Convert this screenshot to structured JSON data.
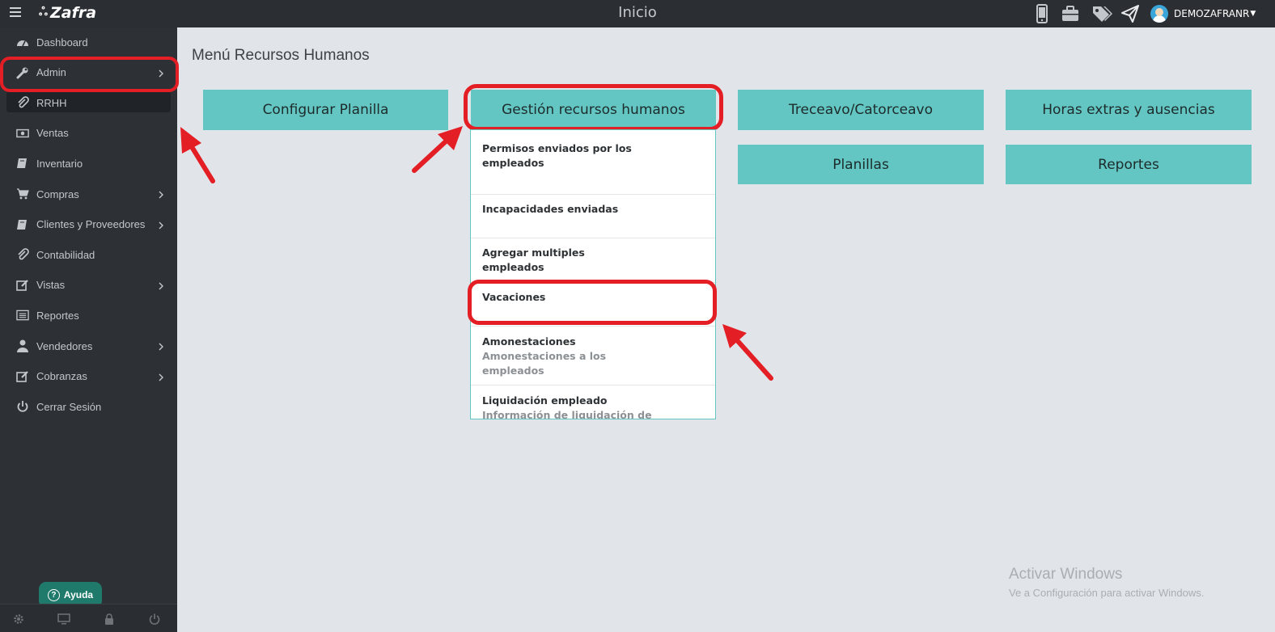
{
  "topbar": {
    "app_name": "Zafra",
    "title": "Inicio",
    "user": "DEMOZAFRANR"
  },
  "sidebar": {
    "items": [
      {
        "label": "Dashboard",
        "icon": "dashboard-icon",
        "has_submenu": false
      },
      {
        "label": "Admin",
        "icon": "wrench-icon",
        "has_submenu": true
      },
      {
        "label": "RRHH",
        "icon": "paperclip-icon",
        "has_submenu": false,
        "active": true
      },
      {
        "label": "Ventas",
        "icon": "money-icon",
        "has_submenu": false
      },
      {
        "label": "Inventario",
        "icon": "book-icon",
        "has_submenu": false
      },
      {
        "label": "Compras",
        "icon": "cart-icon",
        "has_submenu": true
      },
      {
        "label": "Clientes y Proveedores",
        "icon": "book-icon",
        "has_submenu": true
      },
      {
        "label": "Contabilidad",
        "icon": "paperclip-icon",
        "has_submenu": false
      },
      {
        "label": "Vistas",
        "icon": "edit-icon",
        "has_submenu": true
      },
      {
        "label": "Reportes",
        "icon": "list-icon",
        "has_submenu": false
      },
      {
        "label": "Vendedores",
        "icon": "user-icon",
        "has_submenu": true
      },
      {
        "label": "Cobranzas",
        "icon": "edit-icon",
        "has_submenu": true
      },
      {
        "label": "Cerrar Sesión",
        "icon": "power-icon",
        "has_submenu": false
      }
    ],
    "help_label": "Ayuda"
  },
  "main": {
    "page_title": "Menú Recursos Humanos",
    "tiles": [
      "Configurar Planilla",
      "Gestión recursos humanos",
      "Treceavo/Catorceavo",
      "Horas extras y ausencias",
      "Planillas",
      "Reportes"
    ],
    "dropdown": [
      {
        "title": "Permisos enviados por los empleados",
        "subtitle": ""
      },
      {
        "title": "Incapacidades enviadas",
        "subtitle": ""
      },
      {
        "title": "Agregar multiples empleados",
        "subtitle": ""
      },
      {
        "title": "Vacaciones",
        "subtitle": ""
      },
      {
        "title": "Amonestaciones",
        "subtitle": "Amonestaciones a los empleados"
      },
      {
        "title": "Liquidación empleado",
        "subtitle": "Información de liquidación de"
      }
    ]
  },
  "watermark": {
    "title": "Activar Windows",
    "subtitle": "Ve a Configuración para activar Windows."
  },
  "colors": {
    "accent": "#63c6c3",
    "sidebar": "#2d3136",
    "topbar": "#2b2f33",
    "highlight": "#e31e24"
  }
}
